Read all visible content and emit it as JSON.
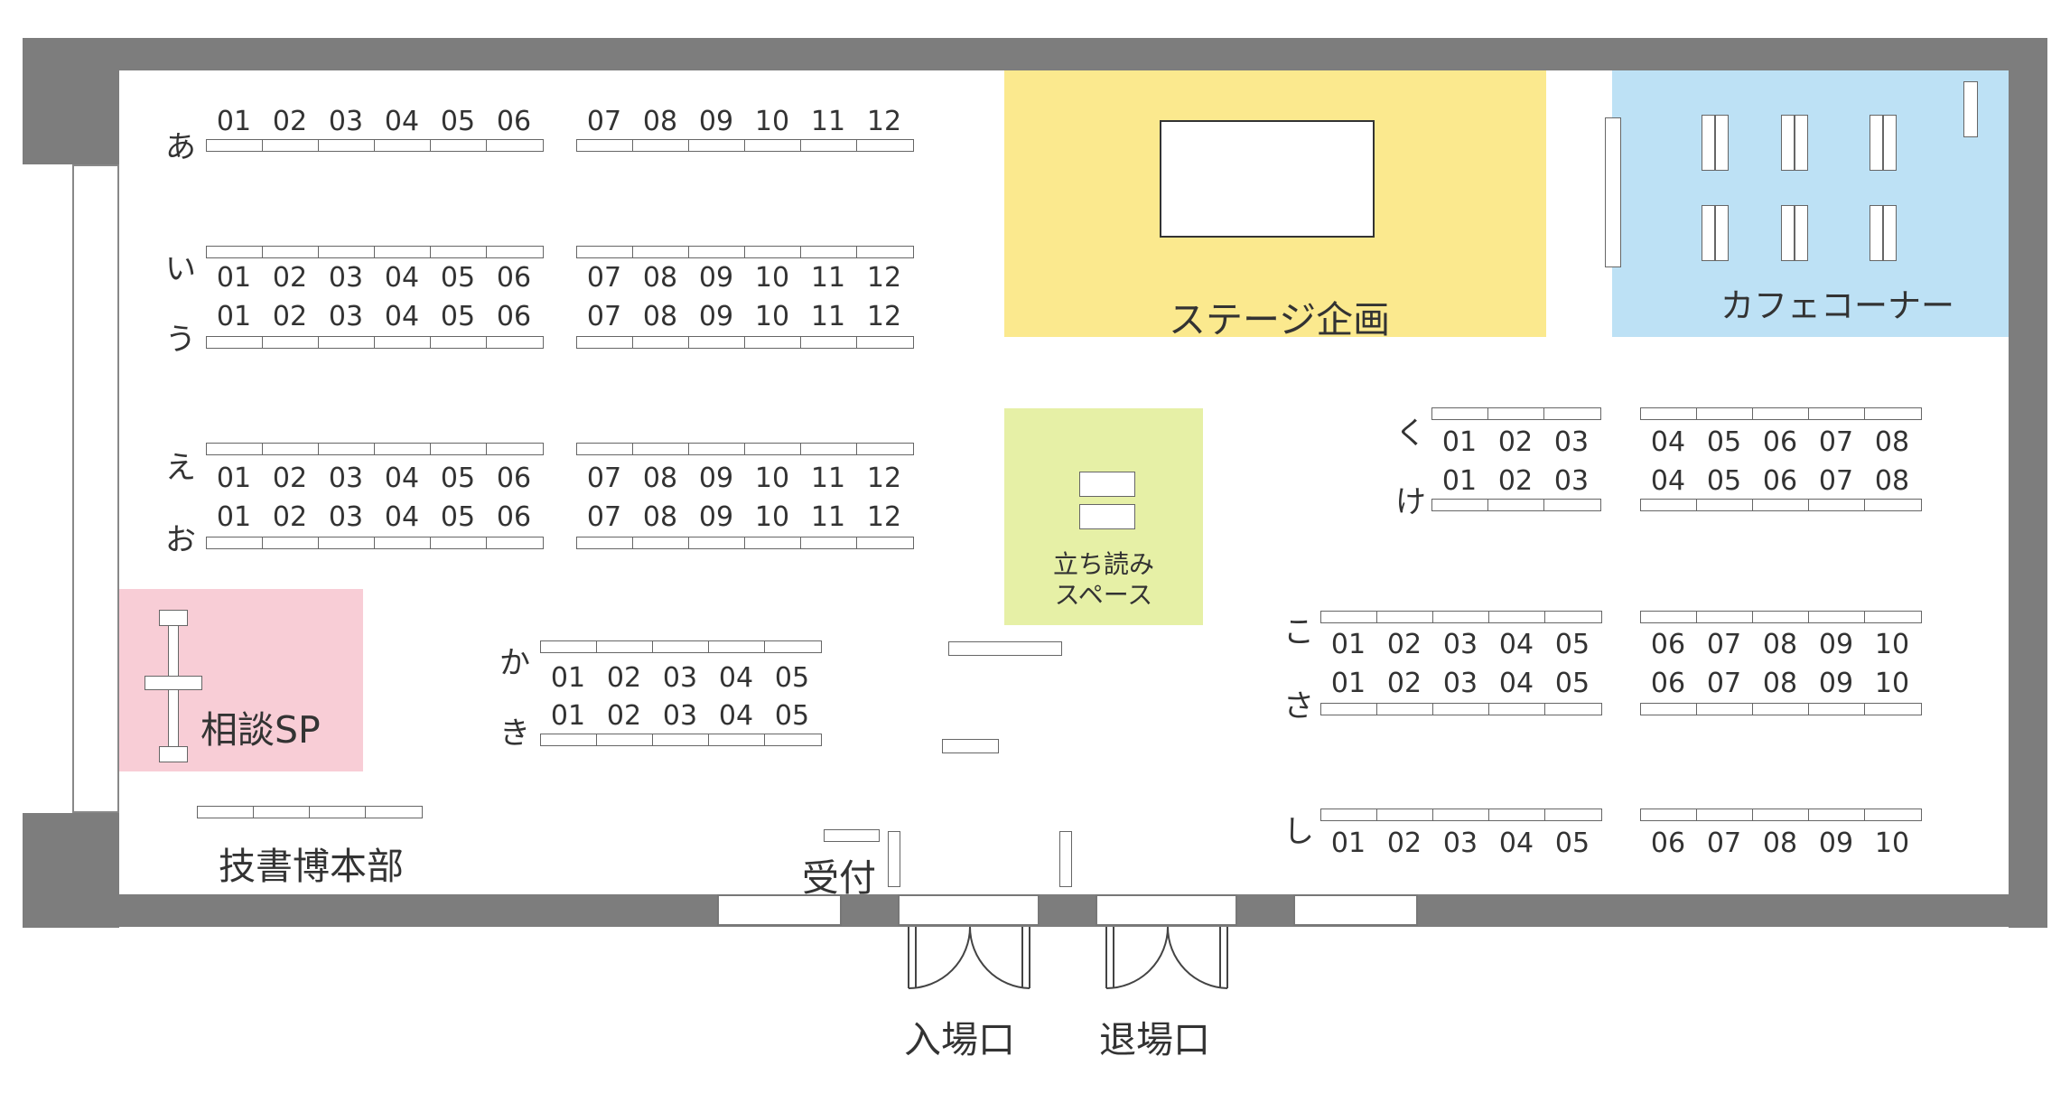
{
  "zones": {
    "stage": {
      "label": "ステージ企画",
      "color": "#fbe98e"
    },
    "cafe": {
      "label": "カフェコーナー",
      "color": "#bde1f5"
    },
    "reading": {
      "label": "立ち読み\nスペース",
      "color": "#e6f0a6"
    },
    "consult": {
      "label": "相談SP",
      "color": "#f8cdd6"
    }
  },
  "labels": {
    "headquarters": "技書博本部",
    "reception": "受付",
    "entrance": "入場口",
    "exit": "退場口"
  },
  "rows": {
    "a": "あ",
    "i": "い",
    "u": "う",
    "e": "え",
    "o": "お",
    "ka": "か",
    "ki": "き",
    "ku": "く",
    "ke": "け",
    "ko": "こ",
    "sa": "さ",
    "shi": "し"
  },
  "numbers": {
    "n01": "01",
    "n02": "02",
    "n03": "03",
    "n04": "04",
    "n05": "05",
    "n06": "06",
    "n07": "07",
    "n08": "08",
    "n09": "09",
    "n10": "10",
    "n11": "11",
    "n12": "12"
  },
  "colors": {
    "wall": "#7d7d7d",
    "desk_border": "#666666"
  }
}
